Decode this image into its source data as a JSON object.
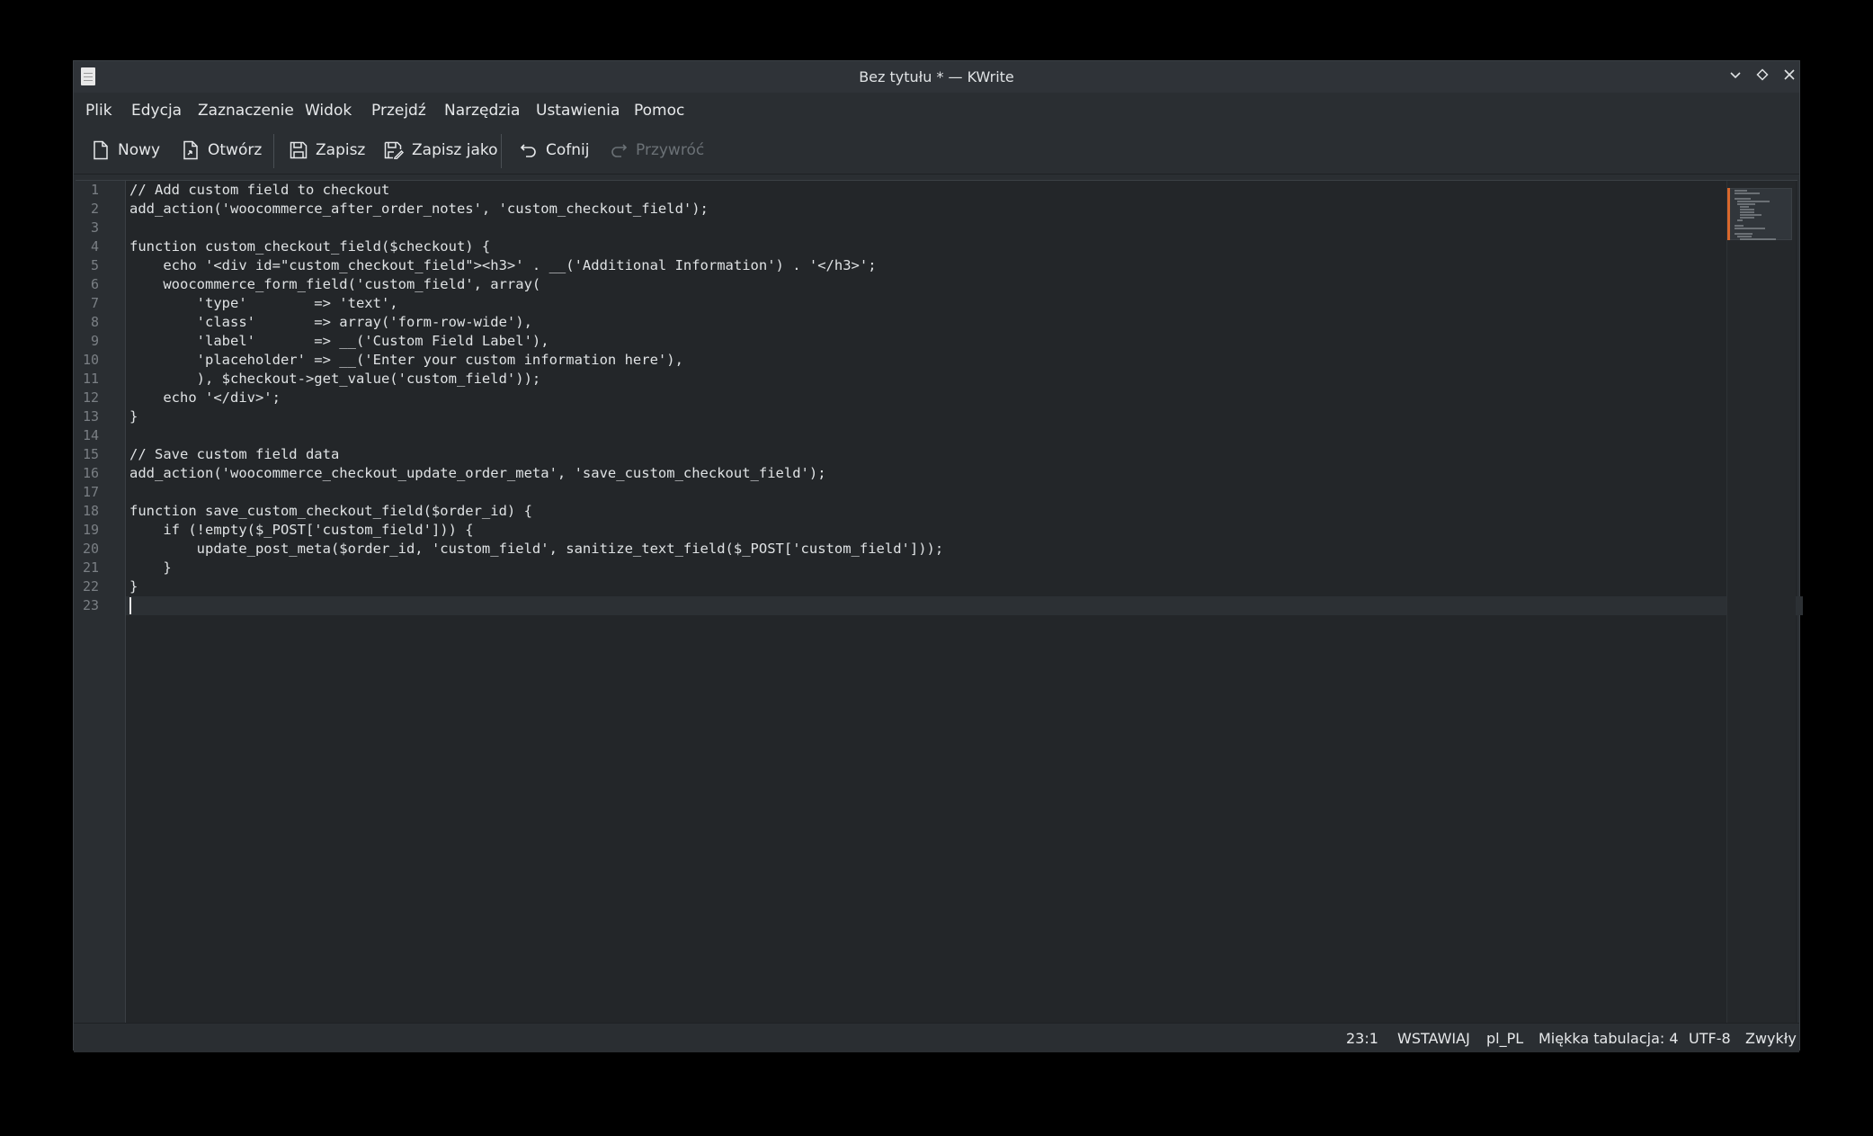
{
  "window": {
    "title": "Bez tytułu * — KWrite"
  },
  "menu": {
    "items": [
      "Plik",
      "Edycja",
      "Zaznaczenie",
      "Widok",
      "Przejdź",
      "Narzędzia",
      "Ustawienia",
      "Pomoc"
    ]
  },
  "toolbar": {
    "new_label": "Nowy",
    "open_label": "Otwórz",
    "save_label": "Zapisz",
    "save_as_label": "Zapisz jako",
    "undo_label": "Cofnij",
    "redo_label": "Przywróć"
  },
  "editor": {
    "line_numbers": [
      "1",
      "2",
      "3",
      "4",
      "5",
      "6",
      "7",
      "8",
      "9",
      "10",
      "11",
      "12",
      "13",
      "14",
      "15",
      "16",
      "17",
      "18",
      "19",
      "20",
      "21",
      "22",
      "23"
    ],
    "lines": [
      "// Add custom field to checkout",
      "add_action('woocommerce_after_order_notes', 'custom_checkout_field');",
      "",
      "function custom_checkout_field($checkout) {",
      "    echo '<div id=\"custom_checkout_field\"><h3>' . __('Additional Information') . '</h3>';",
      "    woocommerce_form_field('custom_field', array(",
      "        'type'        => 'text',",
      "        'class'       => array('form-row-wide'),",
      "        'label'       => __('Custom Field Label'),",
      "        'placeholder' => __('Enter your custom information here'),",
      "        ), $checkout->get_value('custom_field'));",
      "    echo '</div>';",
      "}",
      "",
      "// Save custom field data",
      "add_action('woocommerce_checkout_update_order_meta', 'save_custom_checkout_field');",
      "",
      "function save_custom_checkout_field($order_id) {",
      "    if (!empty($_POST['custom_field'])) {",
      "        update_post_meta($order_id, 'custom_field', sanitize_text_field($_POST['custom_field']));",
      "    }",
      "}",
      ""
    ]
  },
  "status": {
    "position": "23:1",
    "mode": "WSTAWIAJ",
    "language": "pl_PL",
    "indent": "Miękka tabulacja: 4",
    "encoding": "UTF-8",
    "highlighting": "Zwykły"
  }
}
